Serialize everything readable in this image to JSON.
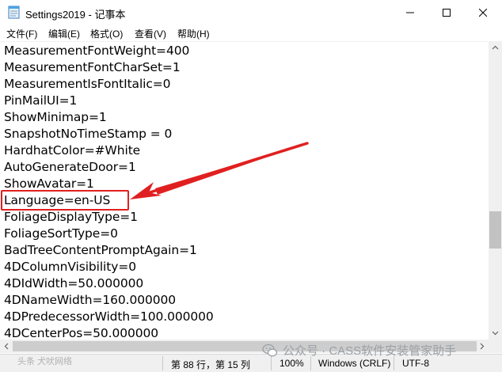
{
  "window": {
    "title": "Settings2019 - 记事本",
    "accent_red": "#e02020"
  },
  "menu": [
    {
      "label": "文件(F)"
    },
    {
      "label": "编辑(E)"
    },
    {
      "label": "格式(O)"
    },
    {
      "label": "查看(V)"
    },
    {
      "label": "帮助(H)"
    }
  ],
  "editor": {
    "lines": [
      "MeasurementFontWeight=400",
      "MeasurementFontCharSet=1",
      "MeasurementIsFontItalic=0",
      "PinMailUI=1",
      "ShowMinimap=1",
      "SnapshotNoTimeStamp = 0",
      "HardhatColor=#White",
      "AutoGenerateDoor=1",
      "ShowAvatar=1",
      "Language=en-US",
      "FoliageDisplayType=1",
      "FoliageSortType=0",
      "BadTreeContentPromptAgain=1",
      "4DColumnVisibility=0",
      "4DIdWidth=50.000000",
      "4DNameWidth=160.000000",
      "4DPredecessorWidth=100.000000",
      "4DCenterPos=50.000000"
    ],
    "highlighted_line": "Language=en-US"
  },
  "statusbar": {
    "position": "第 88 行，第 15 列",
    "zoom": "100%",
    "line_ending": "Windows (CRLF)",
    "encoding": "UTF-8"
  },
  "watermark": {
    "text": "公众号 · CASS软件安装管家助手",
    "left_text": "头条 犬吠网络"
  },
  "icons": {
    "app": "notepad-icon",
    "minimize": "minimize-icon",
    "maximize": "maximize-icon",
    "close": "close-icon"
  }
}
